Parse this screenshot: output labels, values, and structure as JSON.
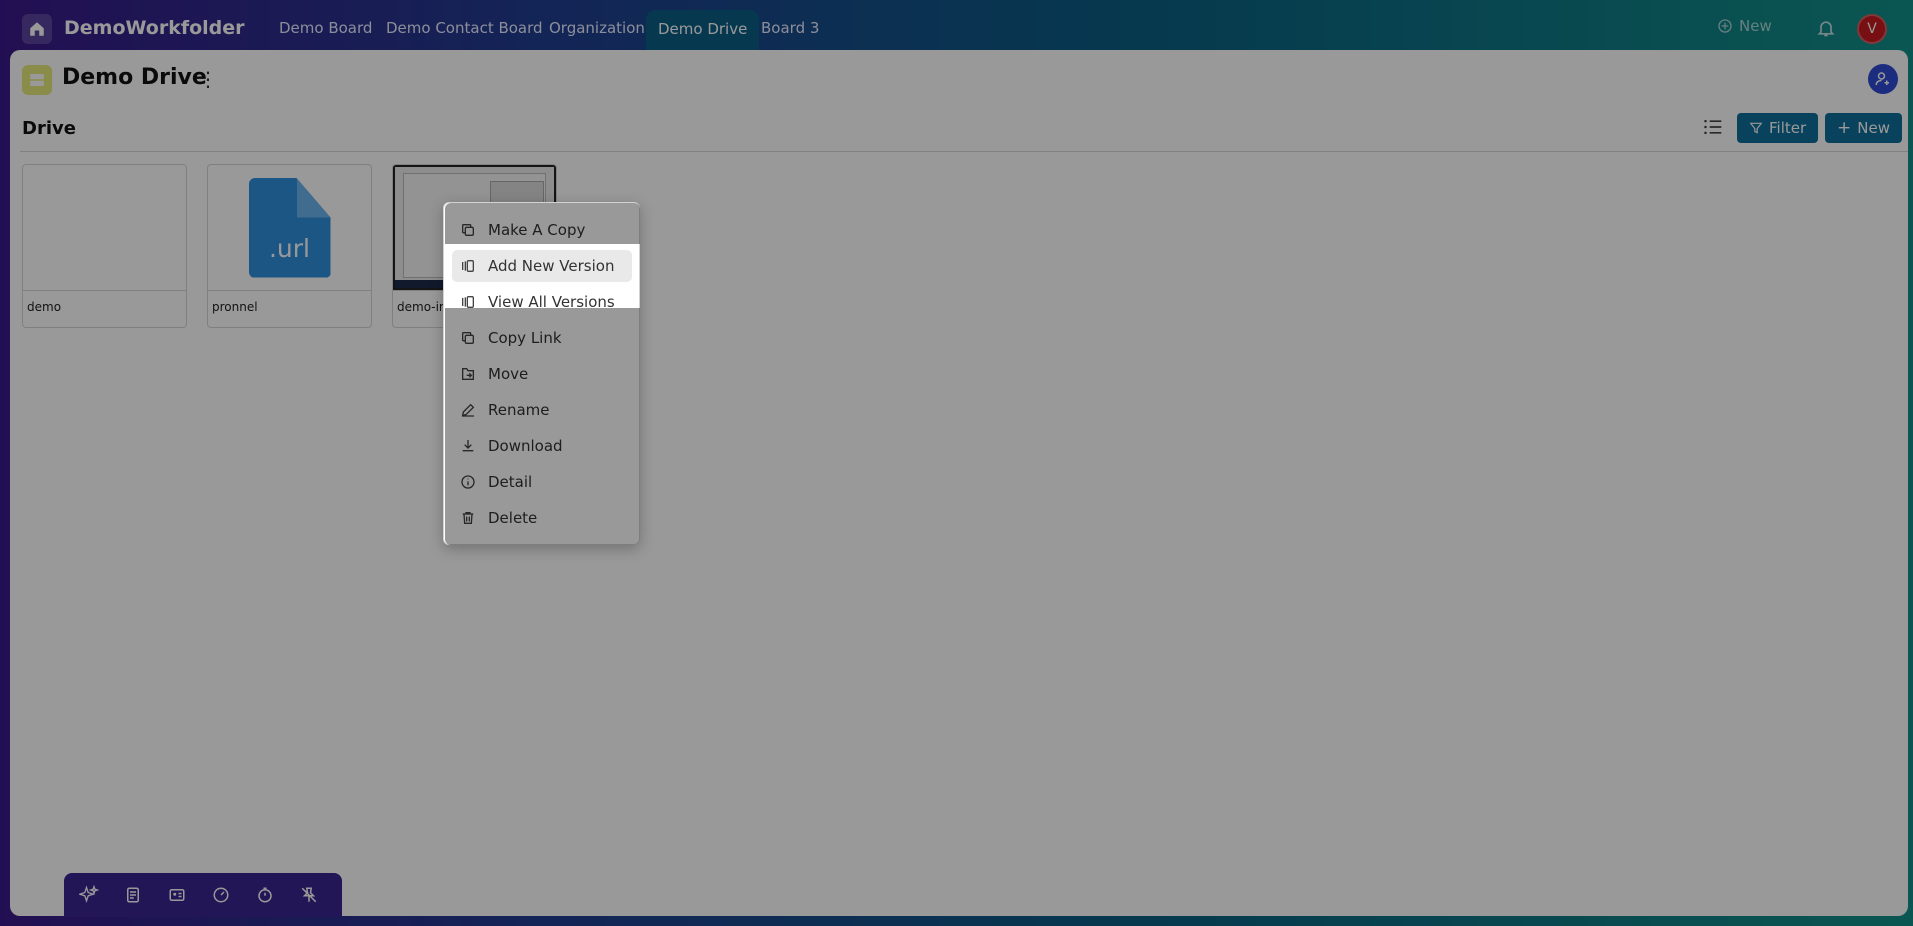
{
  "workspace": {
    "title": "DemoWorkfolder"
  },
  "nav": {
    "tabs": [
      {
        "label": "Demo Board"
      },
      {
        "label": "Demo Contact Board"
      },
      {
        "label": "Organization"
      },
      {
        "label": "Demo Drive"
      },
      {
        "label": "Board 3"
      }
    ],
    "new_label": "New",
    "avatar_initial": "V"
  },
  "page": {
    "title": "Demo Drive",
    "section_title": "Drive"
  },
  "toolbar": {
    "filter_label": "Filter",
    "new_label": "New"
  },
  "files": [
    {
      "name": "demo"
    },
    {
      "name": "pronnel",
      "icon_text": ".url"
    },
    {
      "name": "demo-im"
    }
  ],
  "context_menu": {
    "items": [
      {
        "label": "Make A Copy",
        "icon": "copy-icon"
      },
      {
        "label": "Add New Version",
        "icon": "version-icon"
      },
      {
        "label": "View All Versions",
        "icon": "versions-icon"
      },
      {
        "label": "Copy Link",
        "icon": "link-copy-icon"
      },
      {
        "label": "Move",
        "icon": "move-icon"
      },
      {
        "label": "Rename",
        "icon": "pencil-icon"
      },
      {
        "label": "Download",
        "icon": "download-icon"
      },
      {
        "label": "Detail",
        "icon": "info-icon"
      },
      {
        "label": "Delete",
        "icon": "trash-icon"
      }
    ]
  },
  "dock": {
    "icons": [
      "apps-grid-icon",
      "sparkle-icon",
      "notes-icon",
      "contact-card-icon",
      "gauge-icon",
      "timer-icon",
      "unpin-icon"
    ]
  },
  "colors": {
    "accent": "#0e6f9a",
    "avatar": "#c8191f",
    "dock": "#3a2592"
  }
}
